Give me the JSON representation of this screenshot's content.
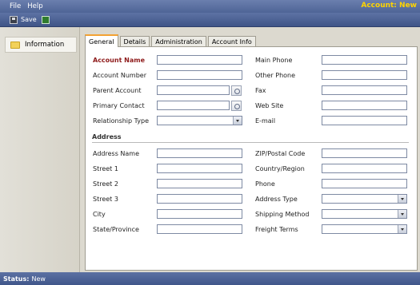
{
  "menu": {
    "file": "File",
    "help": "Help"
  },
  "app_title": "Account: New",
  "toolbar": {
    "save_label": "Save",
    "save_icon": "save-icon",
    "new_icon": "new-record-icon"
  },
  "sidebar": {
    "items": [
      {
        "label": "Information",
        "icon": "folder-icon"
      }
    ]
  },
  "tabs": [
    {
      "label": "General",
      "active": true
    },
    {
      "label": "Details",
      "active": false
    },
    {
      "label": "Administration",
      "active": false
    },
    {
      "label": "Account Info",
      "active": false
    }
  ],
  "general": {
    "account_name": {
      "label": "Account Name",
      "value": ""
    },
    "account_number": {
      "label": "Account Number",
      "value": ""
    },
    "parent_account": {
      "label": "Parent Account",
      "value": ""
    },
    "primary_contact": {
      "label": "Primary Contact",
      "value": ""
    },
    "relationship_type": {
      "label": "Relationship Type",
      "value": ""
    },
    "main_phone": {
      "label": "Main Phone",
      "value": ""
    },
    "other_phone": {
      "label": "Other Phone",
      "value": ""
    },
    "fax": {
      "label": "Fax",
      "value": ""
    },
    "web_site": {
      "label": "Web Site",
      "value": ""
    },
    "email": {
      "label": "E-mail",
      "value": ""
    }
  },
  "address": {
    "section_title": "Address",
    "address_name": {
      "label": "Address Name",
      "value": ""
    },
    "street1": {
      "label": "Street 1",
      "value": ""
    },
    "street2": {
      "label": "Street 2",
      "value": ""
    },
    "street3": {
      "label": "Street 3",
      "value": ""
    },
    "city": {
      "label": "City",
      "value": ""
    },
    "state": {
      "label": "State/Province",
      "value": ""
    },
    "zip": {
      "label": "ZIP/Postal Code",
      "value": ""
    },
    "country": {
      "label": "Country/Region",
      "value": ""
    },
    "phone": {
      "label": "Phone",
      "value": ""
    },
    "address_type": {
      "label": "Address Type",
      "value": ""
    },
    "shipping_method": {
      "label": "Shipping Method",
      "value": ""
    },
    "freight_terms": {
      "label": "Freight Terms",
      "value": ""
    }
  },
  "status": {
    "label": "Status:",
    "value": "New"
  },
  "colors": {
    "required_label": "#8e1a1a",
    "title": "#ffd400",
    "active_tab": "#f3a233"
  }
}
